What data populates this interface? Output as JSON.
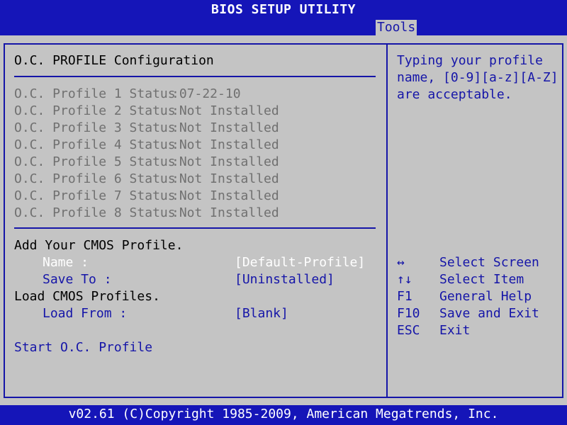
{
  "title": "BIOS SETUP UTILITY",
  "active_tab": "Tools",
  "section_title": "O.C. PROFILE Configuration",
  "profiles": [
    {
      "label": "O.C. Profile 1 Status",
      "value": ":07-22-10"
    },
    {
      "label": "O.C. Profile 2 Status",
      "value": ":Not Installed"
    },
    {
      "label": "O.C. Profile 3 Status",
      "value": ":Not Installed"
    },
    {
      "label": "O.C. Profile 4 Status",
      "value": ":Not Installed"
    },
    {
      "label": "O.C. Profile 5 Status",
      "value": ":Not Installed"
    },
    {
      "label": "O.C. Profile 6 Status",
      "value": ":Not Installed"
    },
    {
      "label": "O.C. Profile 7 Status",
      "value": ":Not Installed"
    },
    {
      "label": "O.C. Profile 8 Status",
      "value": ":Not Installed"
    }
  ],
  "add_profile": {
    "heading": "Add Your CMOS Profile.",
    "name_label": "Name :",
    "name_value": "[Default-Profile]",
    "save_label": "Save To :",
    "save_value": "[Uninstalled]"
  },
  "load_profiles": {
    "heading": "Load CMOS Profiles.",
    "load_label": "Load From :",
    "load_value": "[Blank]"
  },
  "start_profile": "Start O.C. Profile",
  "help": {
    "text": "Typing your profile\nname, [0-9][a-z][A-Z]\nare acceptable."
  },
  "keys": [
    {
      "key": "↔",
      "desc": "Select Screen"
    },
    {
      "key": "↑↓",
      "desc": "Select Item"
    },
    {
      "key": "F1",
      "desc": "General Help"
    },
    {
      "key": "F10",
      "desc": "Save and Exit"
    },
    {
      "key": "ESC",
      "desc": "Exit"
    }
  ],
  "footer": "v02.61 (C)Copyright 1985-2009, American Megatrends, Inc.",
  "colors": {
    "background": "#c4c4c4",
    "bar": "#1515b8",
    "text_blue": "#1515a8",
    "text_disabled": "#707070",
    "text_selected": "#ffffff"
  }
}
